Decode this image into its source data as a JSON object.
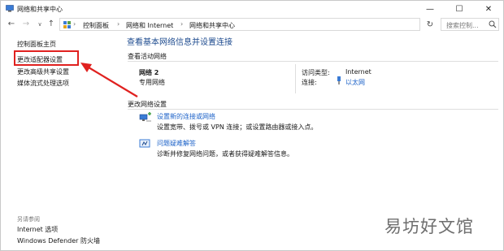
{
  "window": {
    "title": "网络和共享中心",
    "minimize": "—",
    "maximize": "☐",
    "close": "✕"
  },
  "nav": {
    "back": "←",
    "forward": "→",
    "recent": "∨",
    "up": "↑",
    "refresh": "↻",
    "dropdown": "∨"
  },
  "address": {
    "separator": "›",
    "crumbs": [
      "控制面板",
      "网络和 Internet",
      "网络和共享中心"
    ]
  },
  "search": {
    "placeholder": "搜索控制..."
  },
  "sidebar": {
    "items": [
      {
        "label": "控制面板主页"
      },
      {
        "label": "更改适配器设置"
      },
      {
        "label": "更改高级共享设置"
      },
      {
        "label": "媒体流式处理选项"
      }
    ],
    "see_also_heading": "另请参阅",
    "see_also": [
      {
        "label": "Internet 选项"
      },
      {
        "label": "Windows Defender 防火墙"
      }
    ]
  },
  "main": {
    "title": "查看基本网络信息并设置连接",
    "active_networks_label": "查看活动网络",
    "network": {
      "name": "网络 2",
      "type": "专用网络",
      "access_type_label": "访问类型:",
      "access_type_value": "Internet",
      "connections_label": "连接:",
      "connections_value": "以太网"
    },
    "change_settings_label": "更改网络设置",
    "tasks": [
      {
        "link": "设置新的连接或网络",
        "desc": "设置宽带、拨号或 VPN 连接；或设置路由器或接入点。",
        "icon": "network-setup-icon"
      },
      {
        "link": "问题疑难解答",
        "desc": "诊断并修复网络问题，或者获得疑难解答信息。",
        "icon": "troubleshoot-icon"
      }
    ]
  },
  "watermark": "易坊好文馆",
  "colors": {
    "link": "#1c62c8",
    "title": "#1e4b8f",
    "annotation": "#e0211f"
  }
}
